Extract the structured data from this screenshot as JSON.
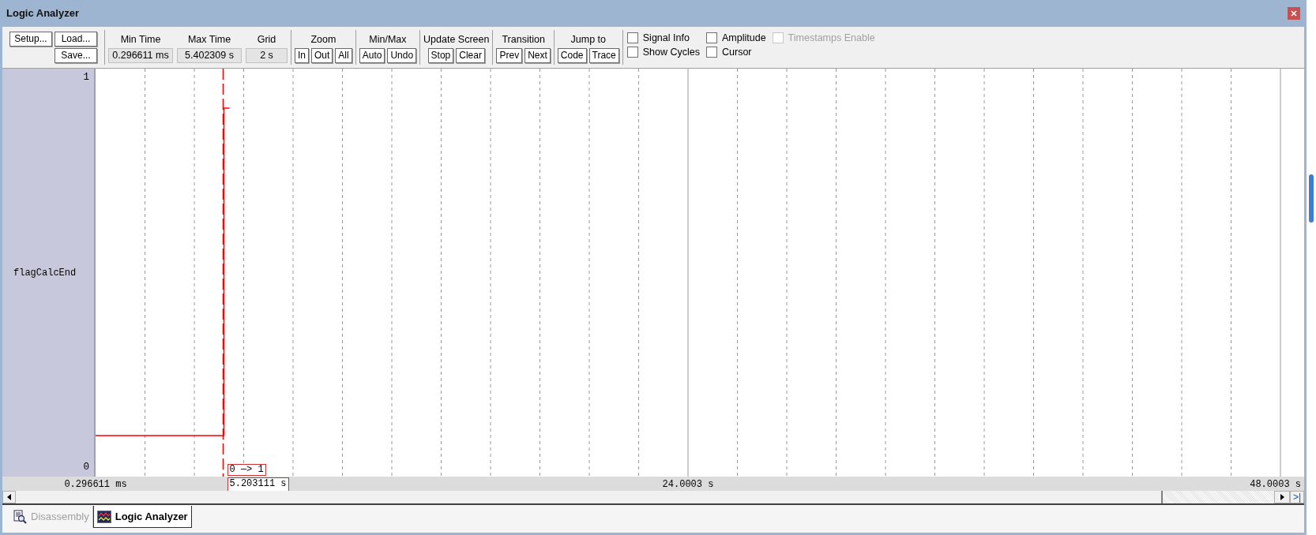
{
  "window": {
    "title": "Logic Analyzer"
  },
  "toolbar": {
    "file_buttons": [
      "Setup...",
      "Load...",
      "Save..."
    ],
    "readouts": [
      {
        "label": "Min Time",
        "value": "0.296611 ms"
      },
      {
        "label": "Max Time",
        "value": "5.402309 s"
      },
      {
        "label": "Grid",
        "value": "2 s"
      }
    ],
    "groups": [
      {
        "label": "Zoom",
        "buttons": [
          "In",
          "Out",
          "All"
        ]
      },
      {
        "label": "Min/Max",
        "buttons": [
          "Auto",
          "Undo"
        ]
      },
      {
        "label": "Update Screen",
        "buttons": [
          "Stop",
          "Clear"
        ]
      },
      {
        "label": "Transition",
        "buttons": [
          "Prev",
          "Next"
        ]
      },
      {
        "label": "Jump to",
        "buttons": [
          "Code",
          "Trace"
        ]
      }
    ],
    "options": [
      {
        "label": "Signal Info",
        "checked": false,
        "disabled": false
      },
      {
        "label": "Amplitude",
        "checked": false,
        "disabled": false
      },
      {
        "label": "Timestamps Enable",
        "checked": false,
        "disabled": true
      },
      {
        "label": "Show Cycles",
        "checked": false,
        "disabled": false
      },
      {
        "label": "Cursor",
        "checked": false,
        "disabled": false
      }
    ]
  },
  "plot": {
    "signal": "flagCalcEnd",
    "cursor": {
      "transition": "0 —> 1",
      "time": "5.203111 s"
    },
    "levels": [
      "1",
      "0"
    ],
    "time_labels": [
      "0.296611 ms",
      "24.0003 s",
      "48.0003 s"
    ]
  },
  "scrollbar": {
    "end_button": ">|"
  },
  "tabs": [
    {
      "label": "Disassembly",
      "selected": false
    },
    {
      "label": "Logic Analyzer",
      "selected": true
    }
  ]
}
